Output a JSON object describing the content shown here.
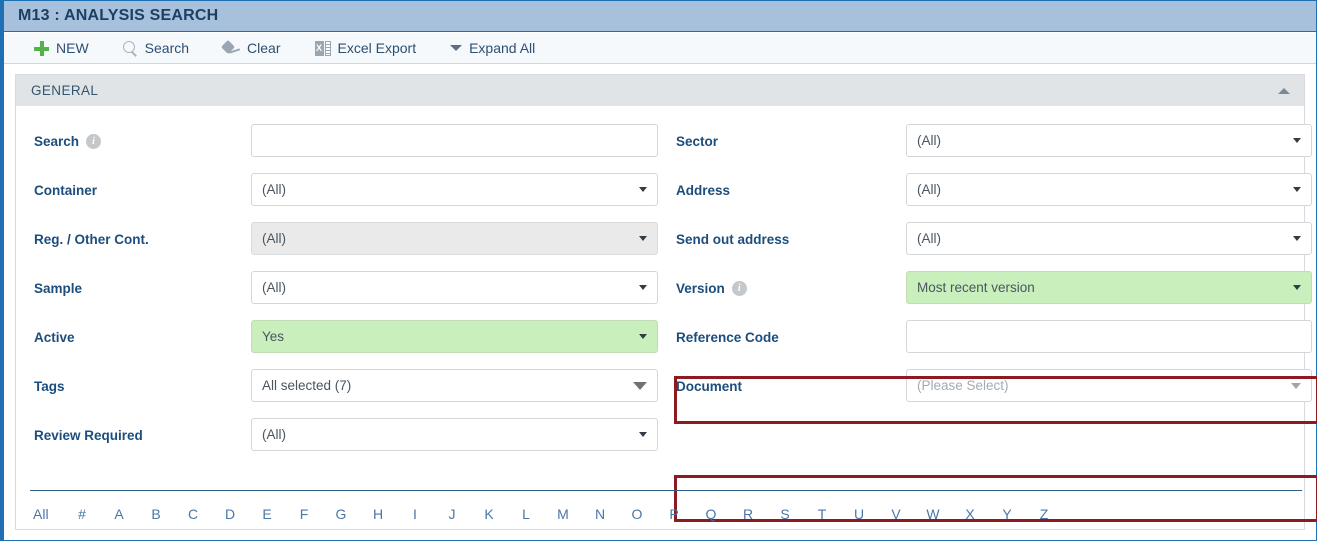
{
  "window": {
    "title": "M13 : ANALYSIS SEARCH"
  },
  "toolbar": {
    "items": [
      {
        "label": "NEW",
        "icon": "plus-icon"
      },
      {
        "label": "Search",
        "icon": "magnifier-icon"
      },
      {
        "label": "Clear",
        "icon": "eraser-icon"
      },
      {
        "label": "Excel Export",
        "icon": "excel-icon"
      },
      {
        "label": "Expand All",
        "icon": "caret-down-icon"
      }
    ]
  },
  "section": {
    "title": "GENERAL",
    "collapse_icon": "caret-up-icon"
  },
  "form": {
    "left": [
      {
        "label": "Search",
        "info": true,
        "type": "text",
        "value": "",
        "state": "normal"
      },
      {
        "label": "Container",
        "info": false,
        "type": "select",
        "value": "(All)",
        "state": "normal"
      },
      {
        "label": "Reg. / Other Cont.",
        "info": false,
        "type": "select",
        "value": "(All)",
        "state": "disabled"
      },
      {
        "label": "Sample",
        "info": false,
        "type": "select",
        "value": "(All)",
        "state": "normal"
      },
      {
        "label": "Active",
        "info": false,
        "type": "select",
        "value": "Yes",
        "state": "green"
      },
      {
        "label": "Tags",
        "info": false,
        "type": "multiselect",
        "value": "All selected (7)",
        "state": "normal"
      },
      {
        "label": "Review Required",
        "info": false,
        "type": "select",
        "value": "(All)",
        "state": "normal"
      }
    ],
    "right": [
      {
        "label": "Sector",
        "info": false,
        "type": "select",
        "value": "(All)",
        "state": "normal"
      },
      {
        "label": "Address",
        "info": false,
        "type": "select",
        "value": "(All)",
        "state": "normal"
      },
      {
        "label": "Send out address",
        "info": false,
        "type": "select",
        "value": "(All)",
        "state": "normal"
      },
      {
        "label": "Version",
        "info": true,
        "type": "select",
        "value": "Most recent version",
        "state": "green",
        "highlighted": true
      },
      {
        "label": "Reference Code",
        "info": false,
        "type": "text",
        "value": "",
        "state": "normal"
      },
      {
        "label": "Document",
        "info": false,
        "type": "lookup",
        "value": "(Please Select)",
        "state": "placeholder",
        "highlighted": true
      }
    ]
  },
  "alphabet": {
    "items": [
      "All",
      "#",
      "A",
      "B",
      "C",
      "D",
      "E",
      "F",
      "G",
      "H",
      "I",
      "J",
      "K",
      "L",
      "M",
      "N",
      "O",
      "P",
      "Q",
      "R",
      "S",
      "T",
      "U",
      "V",
      "W",
      "X",
      "Y",
      "Z"
    ]
  },
  "colors": {
    "title_bar": "#a7c1dc",
    "panel_border": "#1f6fb4",
    "label_blue": "#1c4d7c",
    "modified_green": "#c9f0bc",
    "highlight_red": "#8c1a20",
    "section_head": "#e1e4e6",
    "link_blue": "#4a77a8"
  }
}
